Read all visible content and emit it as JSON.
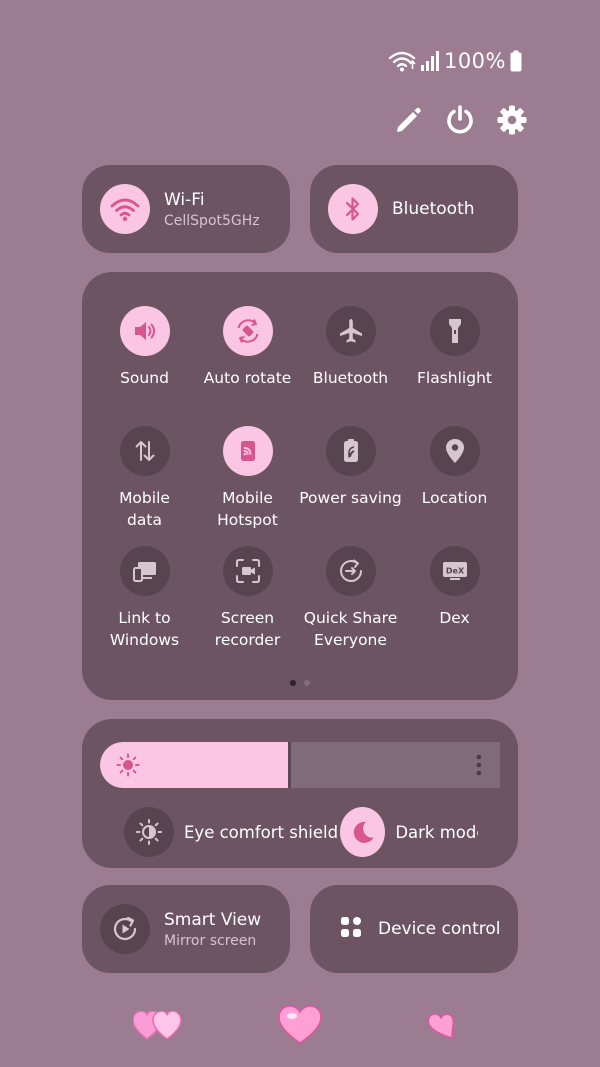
{
  "status": {
    "battery_percent": "100%"
  },
  "wifi": {
    "title": "Wi-Fi",
    "subtitle": "CellSpot5GHz"
  },
  "bluetooth_pill": {
    "title": "Bluetooth"
  },
  "tiles": [
    {
      "label": "Sound",
      "icon": "speaker-icon",
      "on": true
    },
    {
      "label": "Auto rotate",
      "icon": "auto-rotate-icon",
      "on": true
    },
    {
      "label": "Bluetooth",
      "icon": "airplane-icon",
      "on": false
    },
    {
      "label": "Flashlight",
      "icon": "flashlight-icon",
      "on": false
    },
    {
      "label": "Mobile\ndata",
      "icon": "mobile-data-icon",
      "on": false
    },
    {
      "label": "Mobile\nHotspot",
      "icon": "hotspot-icon",
      "on": true
    },
    {
      "label": "Power saving",
      "icon": "power-saving-icon",
      "on": false
    },
    {
      "label": "Location",
      "icon": "location-pin-icon",
      "on": false
    },
    {
      "label": "Link to\nWindows",
      "icon": "link-to-windows-icon",
      "on": false
    },
    {
      "label": "Screen\nrecorder",
      "icon": "screen-recorder-icon",
      "on": false
    },
    {
      "label": "Quick Share\nEveryone",
      "icon": "quick-share-icon",
      "on": false
    },
    {
      "label": "Dex",
      "icon": "dex-icon",
      "on": false
    }
  ],
  "pager": {
    "current": 1,
    "total": 2
  },
  "brightness": {
    "level": 0.47
  },
  "eye_comfort": {
    "label": "Eye comfort shield",
    "on": false
  },
  "dark_mode": {
    "label": "Dark mode",
    "on": true
  },
  "smart_view": {
    "title": "Smart View",
    "subtitle": "Mirror screen"
  },
  "device_control": {
    "title": "Device control"
  },
  "colors": {
    "background": "#9c7c91",
    "panel": "#6d5462",
    "accent": "#fbc6e4",
    "icon_on": "#d8568f",
    "icon_off": "#d6c6d0"
  }
}
